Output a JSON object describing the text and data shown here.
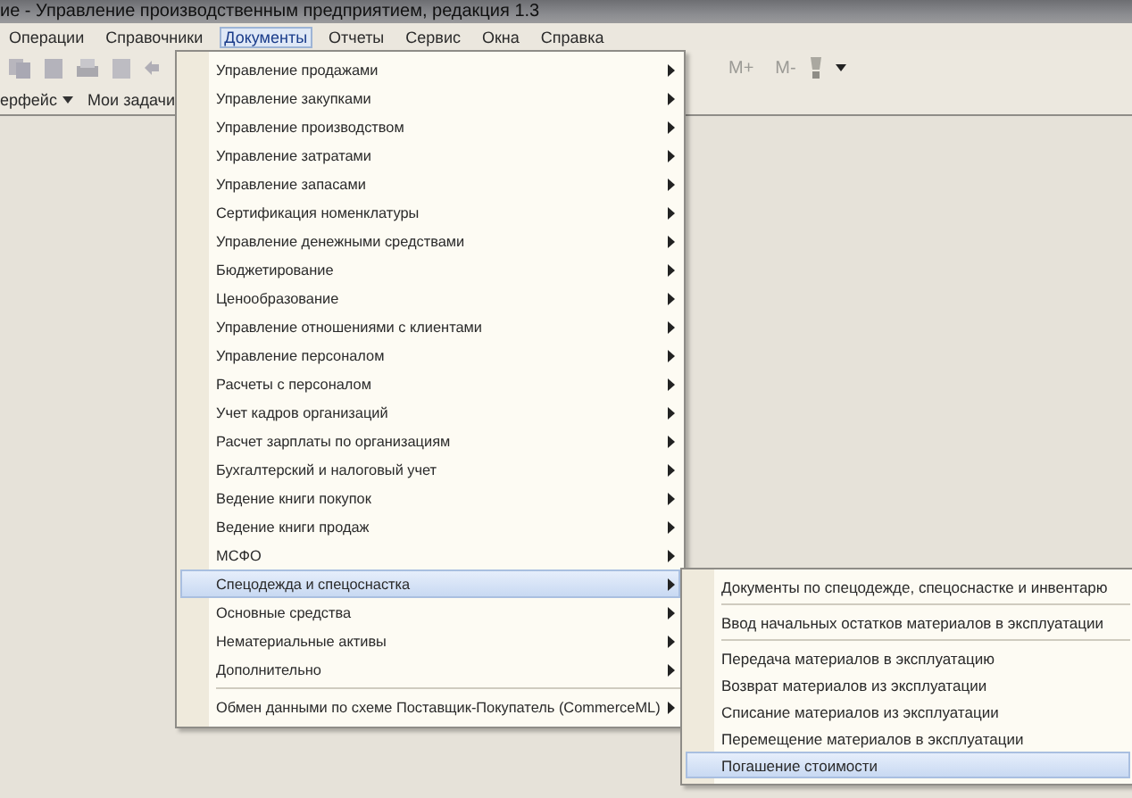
{
  "window": {
    "title": "ие - Управление производственным предприятием, редакция 1.3"
  },
  "menu_bar": [
    {
      "label": "Операции",
      "selected": false
    },
    {
      "label": "Справочники",
      "selected": false
    },
    {
      "label": "Документы",
      "selected": true
    },
    {
      "label": "Отчеты",
      "selected": false
    },
    {
      "label": "Сервис",
      "selected": false
    },
    {
      "label": "Окна",
      "selected": false
    },
    {
      "label": "Справка",
      "selected": false
    }
  ],
  "toolbar": {
    "buttons": [
      "M+",
      "M-"
    ]
  },
  "panel_bar": {
    "items": [
      {
        "label": "ерфейс",
        "dropdown": true
      },
      {
        "label": "Мои задачи",
        "dropdown": false
      }
    ]
  },
  "documents_menu": [
    {
      "kind": "item",
      "label": "Управление продажами",
      "selected": false
    },
    {
      "kind": "item",
      "label": "Управление закупками",
      "selected": false
    },
    {
      "kind": "item",
      "label": "Управление производством",
      "selected": false
    },
    {
      "kind": "item",
      "label": "Управление затратами",
      "selected": false
    },
    {
      "kind": "item",
      "label": "Управление запасами",
      "selected": false
    },
    {
      "kind": "item",
      "label": "Сертификация номенклатуры",
      "selected": false
    },
    {
      "kind": "item",
      "label": "Управление денежными средствами",
      "selected": false
    },
    {
      "kind": "item",
      "label": "Бюджетирование",
      "selected": false
    },
    {
      "kind": "item",
      "label": "Ценообразование",
      "selected": false
    },
    {
      "kind": "item",
      "label": "Управление отношениями с клиентами",
      "selected": false
    },
    {
      "kind": "item",
      "label": "Управление персоналом",
      "selected": false
    },
    {
      "kind": "item",
      "label": "Расчеты с персоналом",
      "selected": false
    },
    {
      "kind": "item",
      "label": "Учет кадров организаций",
      "selected": false
    },
    {
      "kind": "item",
      "label": "Расчет зарплаты по организациям",
      "selected": false
    },
    {
      "kind": "item",
      "label": "Бухгалтерский и налоговый учет",
      "selected": false
    },
    {
      "kind": "item",
      "label": "Ведение книги покупок",
      "selected": false
    },
    {
      "kind": "item",
      "label": "Ведение книги продаж",
      "selected": false
    },
    {
      "kind": "item",
      "label": "МСФО",
      "selected": false
    },
    {
      "kind": "item",
      "label": "Спецодежда и спецоснастка",
      "selected": true
    },
    {
      "kind": "item",
      "label": "Основные средства",
      "selected": false
    },
    {
      "kind": "item",
      "label": "Нематериальные активы",
      "selected": false
    },
    {
      "kind": "item",
      "label": "Дополнительно",
      "selected": false
    },
    {
      "kind": "separator"
    },
    {
      "kind": "item",
      "label": "Обмен данными по схеме Поставщик-Покупатель (CommerceML)",
      "selected": false
    }
  ],
  "submenu": [
    {
      "kind": "item",
      "label": "Документы по спецодежде, спецоснастке и инвентарю",
      "selected": false
    },
    {
      "kind": "separator"
    },
    {
      "kind": "item",
      "label": "Ввод начальных остатков материалов в эксплуатации",
      "selected": false
    },
    {
      "kind": "separator"
    },
    {
      "kind": "item",
      "label": "Передача материалов в эксплуатацию",
      "selected": false
    },
    {
      "kind": "item",
      "label": "Возврат материалов из эксплуатации",
      "selected": false
    },
    {
      "kind": "item",
      "label": "Списание материалов из эксплуатации",
      "selected": false
    },
    {
      "kind": "item",
      "label": "Перемещение материалов в эксплуатации",
      "selected": false
    },
    {
      "kind": "item",
      "label": "Погашение стоимости",
      "selected": true
    }
  ]
}
